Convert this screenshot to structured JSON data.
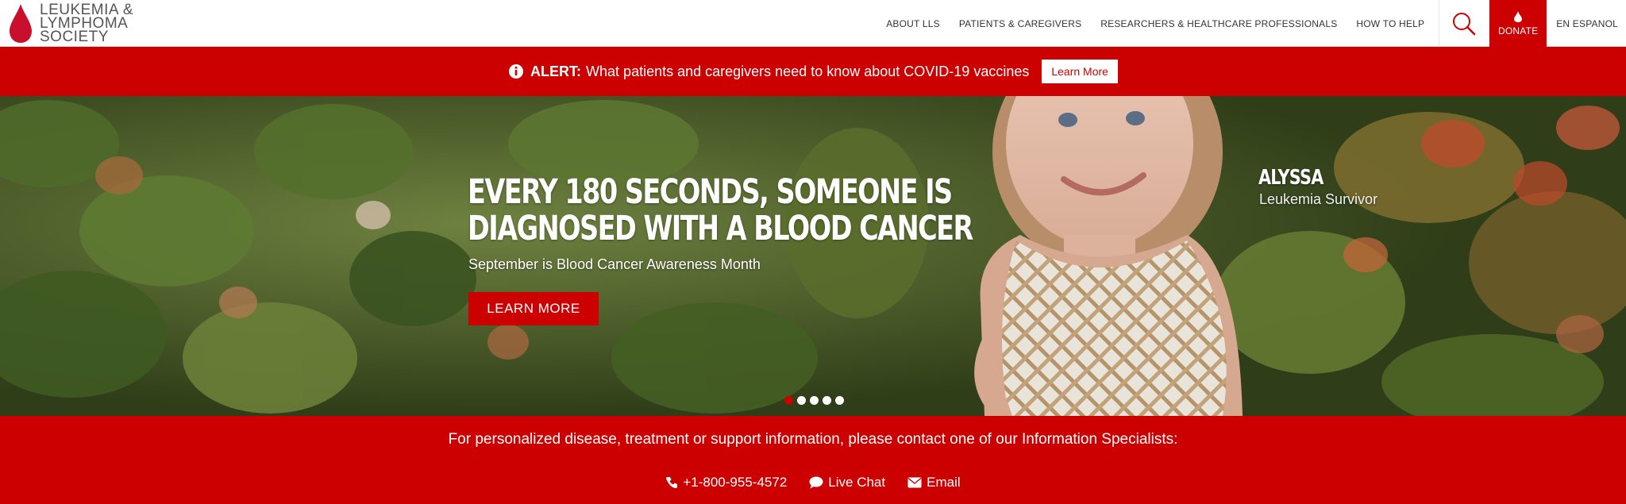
{
  "header": {
    "logo_lines": [
      "LEUKEMIA &",
      "LYMPHOMA",
      "SOCIETY"
    ],
    "nav": [
      {
        "label": "ABOUT LLS"
      },
      {
        "label": "PATIENTS & CAREGIVERS"
      },
      {
        "label": "RESEARCHERS & HEALTHCARE PROFESSIONALS"
      },
      {
        "label": "HOW TO HELP"
      }
    ],
    "donate_label": "DONATE",
    "language_label": "EN ESPANOL",
    "search_icon": "search-icon",
    "brand_color": "#cc0000"
  },
  "alert": {
    "icon": "info-icon",
    "label": "ALERT:",
    "text": "What patients and caregivers need to know about COVID-19 vaccines",
    "button": "Learn More"
  },
  "hero": {
    "title_line1": "EVERY 180 SECONDS, SOMEONE IS",
    "title_line2": "DIAGNOSED WITH A BLOOD CANCER",
    "subtitle": "September is Blood Cancer Awareness Month",
    "button": "LEARN MORE",
    "person_name": "ALYSSA",
    "person_role": "Leukemia Survivor",
    "slides": 5,
    "active_slide": 1
  },
  "info": {
    "text": "For personalized disease, treatment or support information, please contact one of our Information Specialists:",
    "phone": "+1-800-955-4572",
    "chat": "Live Chat",
    "email": "Email"
  }
}
